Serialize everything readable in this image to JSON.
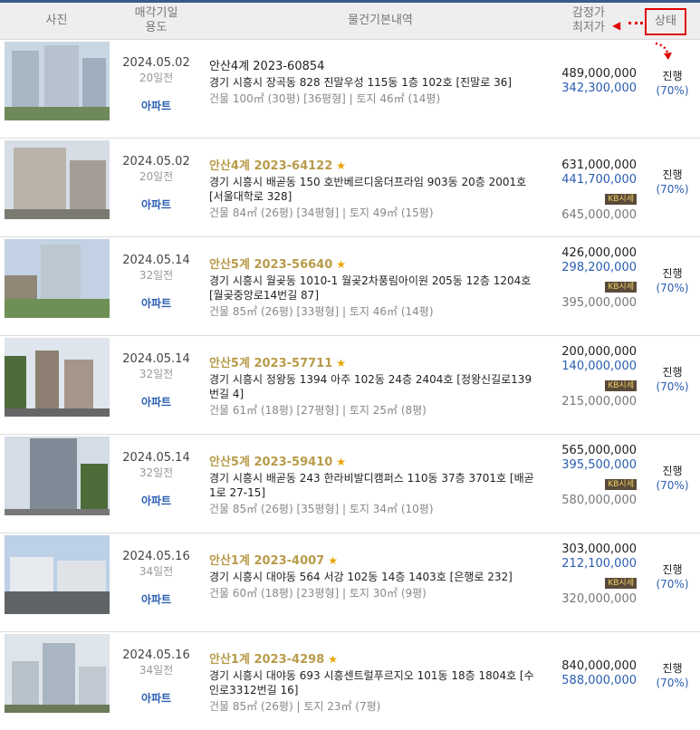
{
  "header": {
    "photo": "사진",
    "date_line1": "매각기일",
    "date_line2": "용도",
    "description": "물건기본내역",
    "price_line1": "감정가",
    "price_line2": "최저가",
    "status": "상태"
  },
  "listings": [
    {
      "date": "2024.05.02",
      "elapsed": "20일전",
      "usage": "아파트",
      "case": "안산4계 2023-60854",
      "starred": false,
      "address": "경기 시흥시 장곡동 828 진말우성 115동 1층 102호 [진말로 36]",
      "area": "건물 100㎡ (30평) [36평형]  |  토지 46㎡ (14평)",
      "appraisal": "489,000,000",
      "minimum": "342,300,000",
      "kb_label": "",
      "market": "",
      "status": "진행",
      "percent": "(70%)"
    },
    {
      "date": "2024.05.02",
      "elapsed": "20일전",
      "usage": "아파트",
      "case": "안산4계 2023-64122",
      "starred": true,
      "address": "경기 시흥시 배곧동 150 호반베르디움더프라임 903동 20층 2001호 [서울대학로 328]",
      "area": "건물 84㎡ (26평) [34평형]  |  토지 49㎡ (15평)",
      "appraisal": "631,000,000",
      "minimum": "441,700,000",
      "kb_label": "KB시세",
      "market": "645,000,000",
      "status": "진행",
      "percent": "(70%)"
    },
    {
      "date": "2024.05.14",
      "elapsed": "32일전",
      "usage": "아파트",
      "case": "안산5계 2023-56640",
      "starred": true,
      "address": "경기 시흥시 월곶동 1010-1 월곶2차풍림아이원 205동 12층 1204호 [월곶중앙로14번길 87]",
      "area": "건물 85㎡ (26평) [33평형]  |  토지 46㎡ (14평)",
      "appraisal": "426,000,000",
      "minimum": "298,200,000",
      "kb_label": "KB시세",
      "market": "395,000,000",
      "status": "진행",
      "percent": "(70%)"
    },
    {
      "date": "2024.05.14",
      "elapsed": "32일전",
      "usage": "아파트",
      "case": "안산5계 2023-57711",
      "starred": true,
      "address": "경기 시흥시 정왕동 1394 아주 102동 24층 2404호 [정왕신길로139번길 4]",
      "area": "건물 61㎡ (18평) [27평형]  |  토지 25㎡ (8평)",
      "appraisal": "200,000,000",
      "minimum": "140,000,000",
      "kb_label": "KB시세",
      "market": "215,000,000",
      "status": "진행",
      "percent": "(70%)"
    },
    {
      "date": "2024.05.14",
      "elapsed": "32일전",
      "usage": "아파트",
      "case": "안산5계 2023-59410",
      "starred": true,
      "address": "경기 시흥시 배곧동 243 한라비발디캠퍼스 110동 37층 3701호 [배곧1로 27-15]",
      "area": "건물 85㎡ (26평) [35평형]  |  토지 34㎡ (10평)",
      "appraisal": "565,000,000",
      "minimum": "395,500,000",
      "kb_label": "KB시세",
      "market": "580,000,000",
      "status": "진행",
      "percent": "(70%)"
    },
    {
      "date": "2024.05.16",
      "elapsed": "34일전",
      "usage": "아파트",
      "case": "안산1계 2023-4007",
      "starred": true,
      "address": "경기 시흥시 대야동 564 서강 102동 14층 1403호 [은행로 232]",
      "area": "건물 60㎡ (18평) [23평형]  |  토지 30㎡ (9평)",
      "appraisal": "303,000,000",
      "minimum": "212,100,000",
      "kb_label": "KB시세",
      "market": "320,000,000",
      "status": "진행",
      "percent": "(70%)"
    },
    {
      "date": "2024.05.16",
      "elapsed": "34일전",
      "usage": "아파트",
      "case": "안산1계 2023-4298",
      "starred": true,
      "address": "경기 시흥시 대야동 693 시흥센트럴푸르지오 101동 18층 1804호 [수인로3312번길 16]",
      "area": "건물 85㎡ (26평)  |  토지 23㎡ (7평)",
      "appraisal": "840,000,000",
      "minimum": "588,000,000",
      "kb_label": "",
      "market": "",
      "status": "진행",
      "percent": "(70%)"
    }
  ]
}
